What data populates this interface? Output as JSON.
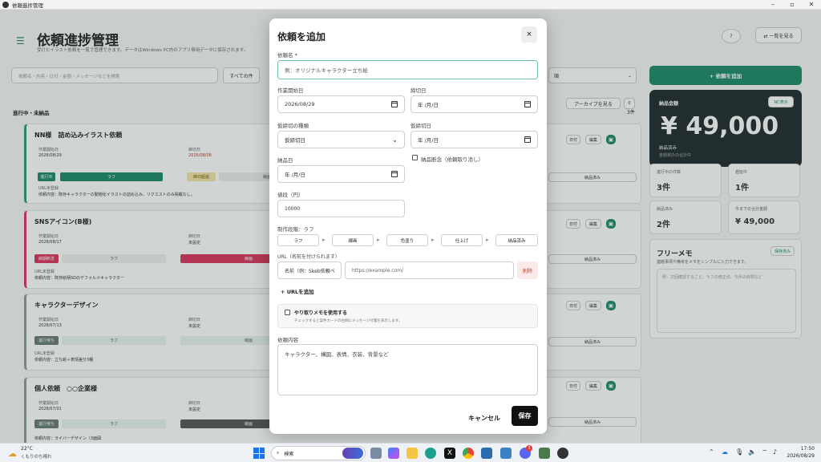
{
  "window": {
    "title": "依頼進捗管理"
  },
  "app": {
    "title": "依頼進捗管理",
    "subtitle": "受けたイラスト依頼を一覧で管理できます。データはWindows PC内のアプリ専用データに保存されます。",
    "help_label": "?",
    "list_button": "⇄ 一覧を見る",
    "search_placeholder": "依頼名・内容・日付・金額・メッセージなどを検索",
    "filter_all": "すべての件",
    "sort_label": "順",
    "add_button": "+ 依頼を追加",
    "section_label": "進行中・未納品",
    "section_count": "3件",
    "archive_button": "アーカイブを見る",
    "cards": [
      {
        "title": "NN様　詰め込みイラスト依頼",
        "start_lbl": "作業開始日",
        "start": "2026/08/29",
        "deadline_lbl": "締切日",
        "deadline": "2026/08/08",
        "stage": "ラフ",
        "memo": "依頼内容：既存キャラクターの動物化イラストの詰め込み、リクエストのみ掲載なし。"
      },
      {
        "title": "SNSアイコン(B様)",
        "start_lbl": "作業開始日",
        "start": "2026/08/17",
        "deadline_lbl": "締切日",
        "deadline": "未設定",
        "stage": "ラフ",
        "memo": "依頼内容：既存絵柄SDのデフォルメキャラクター"
      },
      {
        "title": "キャラクターデザイン",
        "start_lbl": "作業開始日",
        "start": "2026/07/13",
        "deadline_lbl": "締切日",
        "deadline": "未設定",
        "stage": "ラフ",
        "memo": "依頼内容：立ち絵＋表情差分3種"
      },
      {
        "title": "個人依頼　○○企業様",
        "start_lbl": "作業開始日",
        "start": "2026/07/01",
        "deadline_lbl": "締切日",
        "deadline": "未設定",
        "stage": "ラフ",
        "memo": "依頼内容：ライバーデザイン（3面図"
      }
    ],
    "card_buttons": {
      "edit": "編集",
      "done": "納品済み",
      "mid": "日付"
    },
    "summary": {
      "label": "納品金額",
      "amount": "¥ 49,000",
      "sub1": "納品済み",
      "sub2": "金額累計の合計中",
      "toggle": "NC表示"
    },
    "stats": [
      {
        "label": "進行中の件数",
        "value": "3件"
      },
      {
        "label": "遅延中",
        "value": "1件"
      },
      {
        "label": "納品済み",
        "value": "2件"
      },
      {
        "label": "今までの合計金額",
        "value": "¥ 49,000"
      }
    ],
    "free_memo": {
      "title": "フリーメモ",
      "save": "保存済み",
      "desc": "連絡事項や備考をメモをシンプルに入力できます。",
      "placeholder": "例：次回確認すること、ラフの修正点、今月の目標など"
    }
  },
  "modal": {
    "title": "依頼を追加",
    "close": "×",
    "name_label": "依頼名 *",
    "name_placeholder": "例：オリジナルキャラクター立ち絵",
    "start_label": "作業開始日",
    "start_value": "2026/08/29",
    "deadline_label": "締切日",
    "deadline_value": "年 /月/日",
    "ktype_label": "仮締切の種類",
    "ktype_value": "仮締切日",
    "kdate_label": "仮締切日",
    "kdate_value": "年 /月/日",
    "delivery_label": "納品日",
    "delivery_value": "年 /月/日",
    "cancel_check": "納品断念（依頼取り消し）",
    "price_label": "値段（円）",
    "price_value": "10000",
    "stage_label": "制作段階：ラフ",
    "stages": [
      "ラフ",
      "線画",
      "色塗り",
      "仕上げ",
      "納品済み"
    ],
    "url_label": "URL（名前を付けられます）",
    "url_name_placeholder": "名前（例：Skeb依頼ペ",
    "url_placeholder": "https://example.com/",
    "url_delete": "削除",
    "url_add": "+ URLを追加",
    "msg_check": "やり取りメモを使用する",
    "msg_desc": "チェックすると案件カードの右側にメッセージ付箋を表示します。",
    "content_label": "依頼内容",
    "content_placeholder": "キャラクター、構図、表情、衣装、背景など",
    "cancel_button": "キャンセル",
    "save_button": "保存"
  },
  "taskbar": {
    "weather_temp": "22°C",
    "weather_desc": "くもりのち晴れ",
    "search": "検索",
    "time": "17:50",
    "date": "2026/08/29",
    "badge": "3"
  }
}
